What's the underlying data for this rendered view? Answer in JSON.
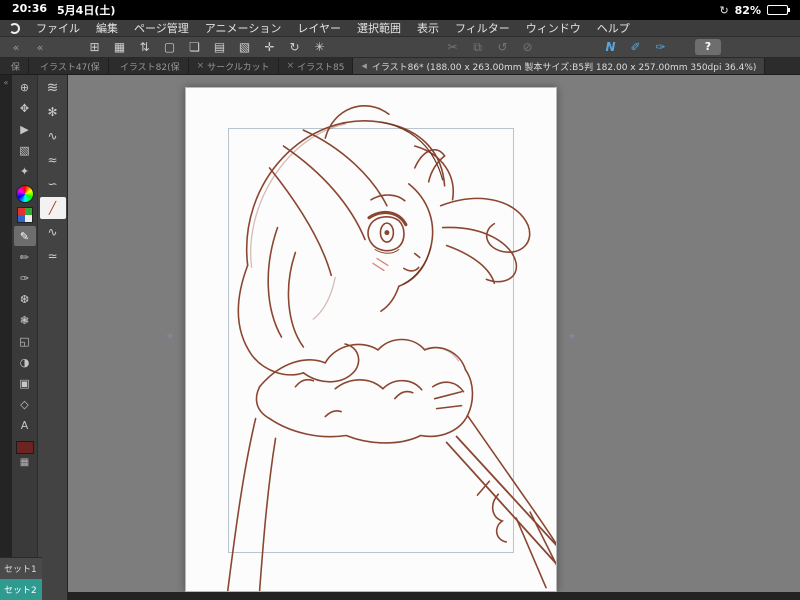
{
  "status_bar": {
    "time": "20:36",
    "date": "5月4日(土)",
    "rotation_icon": "↻",
    "battery_percent": "82%"
  },
  "menu_bar": {
    "items": [
      {
        "name": "menu-file",
        "label": "ファイル"
      },
      {
        "name": "menu-edit",
        "label": "編集"
      },
      {
        "name": "menu-page-manage",
        "label": "ページ管理"
      },
      {
        "name": "menu-animation",
        "label": "アニメーション"
      },
      {
        "name": "menu-layer",
        "label": "レイヤー"
      },
      {
        "name": "menu-selection",
        "label": "選択範囲"
      },
      {
        "name": "menu-view",
        "label": "表示"
      },
      {
        "name": "menu-filter",
        "label": "フィルター"
      },
      {
        "name": "menu-window",
        "label": "ウィンドウ"
      },
      {
        "name": "menu-help",
        "label": "ヘルプ"
      }
    ]
  },
  "toolbar": {
    "collapse_left": "«",
    "collapse_right": "«",
    "main_icons": [
      {
        "name": "workspace-grid-icon",
        "glyph": "⊞",
        "state": "normal"
      },
      {
        "name": "panel-layout-icon",
        "glyph": "▦",
        "state": "normal"
      },
      {
        "name": "size-stepper-icon",
        "glyph": "⇅",
        "state": "normal"
      },
      {
        "name": "new-page-icon",
        "glyph": "▢",
        "state": "normal"
      },
      {
        "name": "duplicate-page-icon",
        "glyph": "❏",
        "state": "normal"
      },
      {
        "name": "bookmark-icon",
        "glyph": "▤",
        "state": "normal"
      },
      {
        "name": "selection-marquee-icon",
        "glyph": "▧",
        "state": "normal"
      },
      {
        "name": "move-canvas-icon",
        "glyph": "✛",
        "state": "normal"
      },
      {
        "name": "rotate-canvas-icon",
        "glyph": "↻",
        "state": "normal"
      },
      {
        "name": "reset-view-icon",
        "glyph": "✳",
        "state": "normal"
      }
    ],
    "disabled_icons": [
      {
        "name": "cut-icon",
        "glyph": "✂",
        "state": "disabled"
      },
      {
        "name": "copy-icon",
        "glyph": "⧉",
        "state": "disabled"
      },
      {
        "name": "undo-icon",
        "glyph": "↺",
        "state": "disabled"
      },
      {
        "name": "redo-icon",
        "glyph": "⊘",
        "state": "disabled"
      }
    ],
    "right_icons": [
      {
        "name": "polyline-tool-icon",
        "glyph": "N",
        "state": "blue"
      },
      {
        "name": "pen-slant-icon",
        "glyph": "✐",
        "state": "blue"
      },
      {
        "name": "pen-vertical-icon",
        "glyph": "✑",
        "state": "blue"
      }
    ],
    "help_label": "?"
  },
  "tab_bar": {
    "tabs": [
      {
        "name": "tab-partial",
        "label": "保",
        "close": ""
      },
      {
        "name": "tab-illust47",
        "label": "イラスト47(保",
        "close": ""
      },
      {
        "name": "tab-illust82",
        "label": "イラスト82(保",
        "close": ""
      },
      {
        "name": "tab-circlecut",
        "label": "サークルカット",
        "close": "×"
      },
      {
        "name": "tab-illust85",
        "label": "イラスト85",
        "close": "×"
      }
    ],
    "active_tab": {
      "indicator": "◀",
      "label": "イラスト86* (188.00 x 263.00mm 製本サイズ:B5判 182.00 x 257.00mm 350dpi 36.4%)"
    }
  },
  "left_panel": {
    "edge_collapse": "«",
    "tools_top": [
      {
        "name": "tool-zoom",
        "glyph": "⊕"
      },
      {
        "name": "tool-move",
        "glyph": "✥"
      },
      {
        "name": "tool-operate",
        "glyph": "▶"
      },
      {
        "name": "tool-select",
        "glyph": "▧"
      },
      {
        "name": "tool-auto-select",
        "glyph": "✦"
      }
    ],
    "tools_mid": [
      {
        "name": "tool-pen",
        "glyph": "✎",
        "selected": true
      },
      {
        "name": "tool-pencil",
        "glyph": "✏"
      },
      {
        "name": "tool-brush",
        "glyph": "✑"
      },
      {
        "name": "tool-airbrush",
        "glyph": "❆"
      },
      {
        "name": "tool-decoration",
        "glyph": "❃"
      },
      {
        "name": "tool-eraser",
        "glyph": "◱"
      },
      {
        "name": "tool-blend",
        "glyph": "◑"
      },
      {
        "name": "tool-fill",
        "glyph": "▣"
      },
      {
        "name": "tool-figure",
        "glyph": "◇"
      },
      {
        "name": "tool-text",
        "glyph": "A"
      }
    ],
    "mini_grid_icon": "▦",
    "sets": [
      {
        "name": "set-1",
        "label": "セット1"
      },
      {
        "name": "set-2",
        "label": "セット2"
      }
    ]
  },
  "sub_panel": {
    "items": [
      {
        "name": "subtool-brush-strokes-icon",
        "glyph": "≋",
        "special": "sub-top"
      },
      {
        "name": "subtool-settings-icon",
        "glyph": "✻"
      },
      {
        "name": "subtool-pen-1",
        "glyph": "∿"
      },
      {
        "name": "subtool-pen-2",
        "glyph": "≈"
      },
      {
        "name": "subtool-pen-3",
        "glyph": "∽"
      },
      {
        "name": "subtool-red-stroke",
        "glyph": "╱",
        "special": "red"
      },
      {
        "name": "subtool-pen-4",
        "glyph": "∿"
      },
      {
        "name": "subtool-pen-5",
        "glyph": "≃"
      }
    ]
  },
  "canvas": {
    "crop_mark": "+"
  },
  "colors": {
    "accent_blue": "#58a6dd",
    "sketch_line": "#8a4630",
    "sketch_line_dark": "#6d331e",
    "set2_teal": "#2f9a8f",
    "current_color": "#6b2420",
    "canvas_gray": "#7d7d7d"
  }
}
